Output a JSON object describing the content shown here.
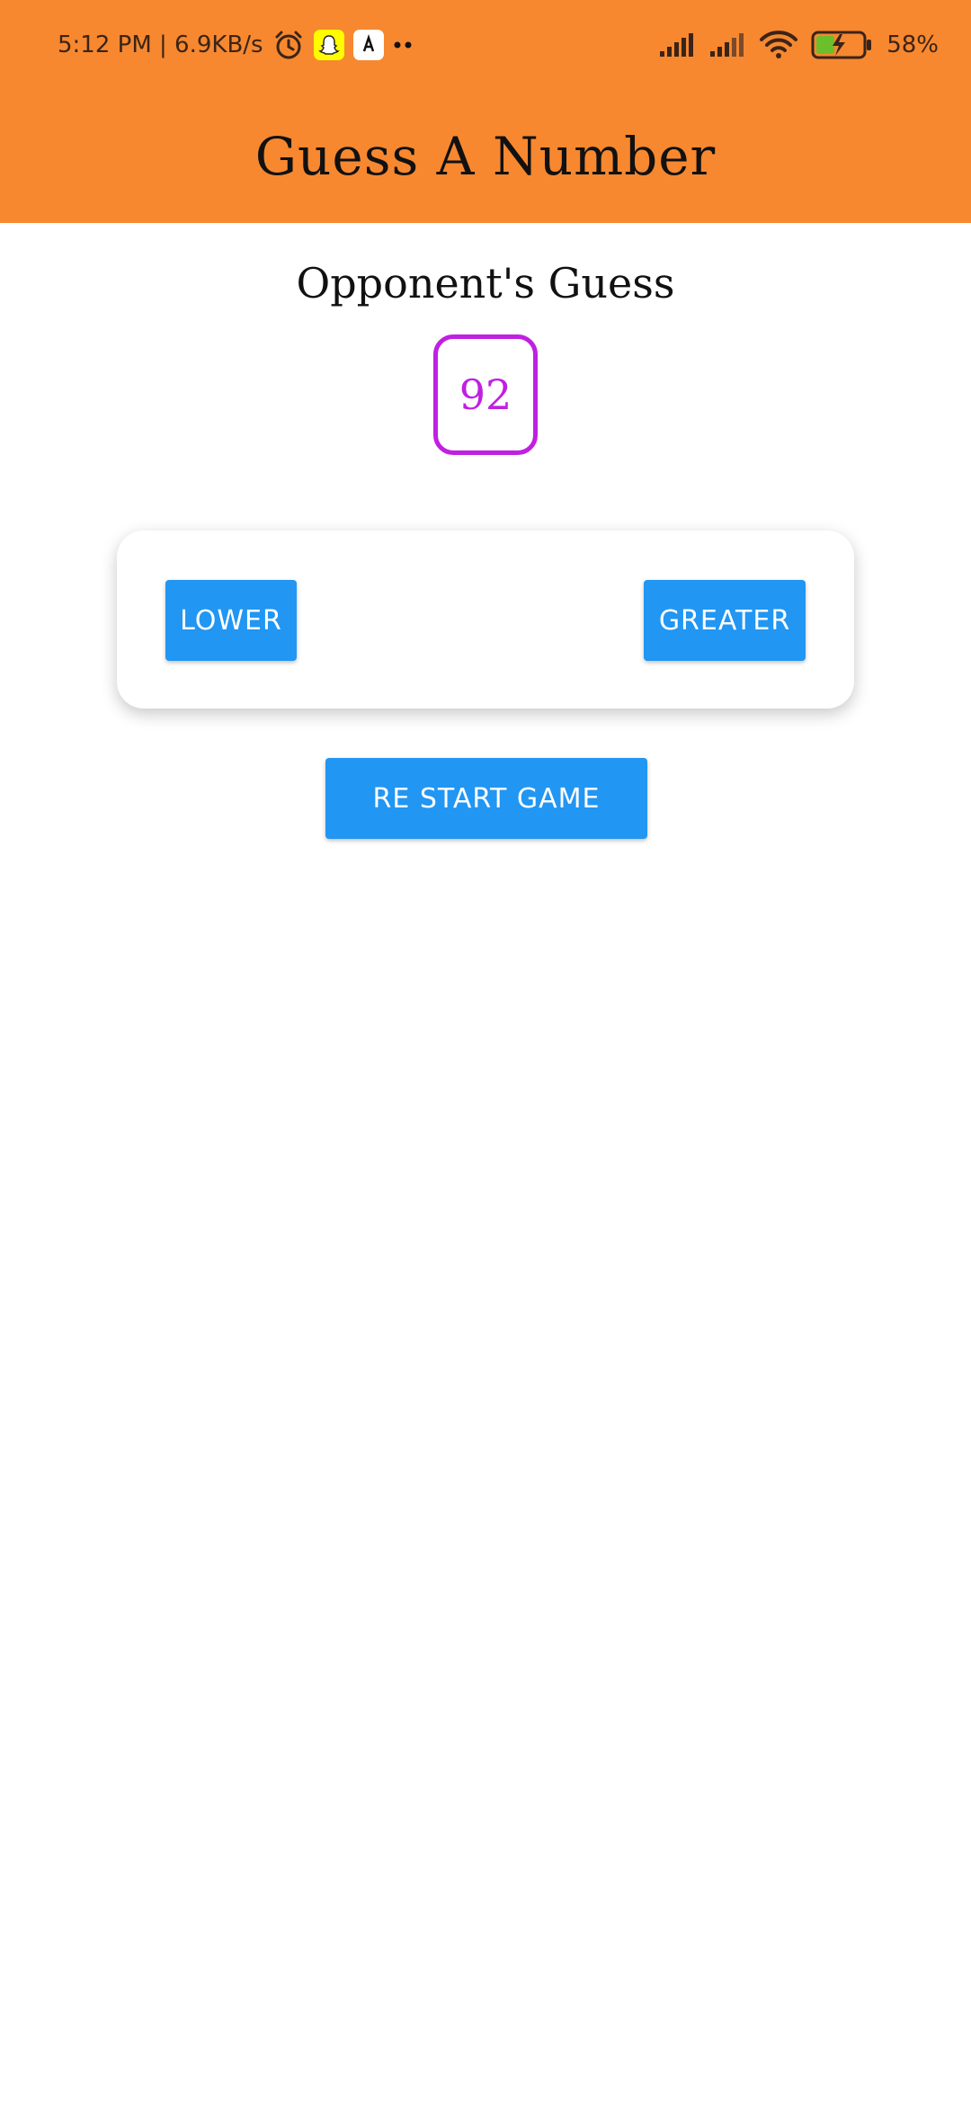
{
  "status_bar": {
    "time_and_speed": "5:12 PM | 6.9KB/s",
    "battery_percent": "58%",
    "icons": [
      "alarm-icon",
      "snapchat-icon",
      "app-notification-icon",
      "more-dots-icon",
      "signal-icon",
      "signal-icon",
      "wifi-icon",
      "battery-charging-icon"
    ]
  },
  "header": {
    "title": "Guess A Number"
  },
  "game": {
    "opponent_label": "Opponent's Guess",
    "opponent_guess": "92",
    "lower_label": "LOWER",
    "greater_label": "GREATER",
    "restart_label": "RE START GAME"
  },
  "colors": {
    "header_bg": "#F7882F",
    "button_bg": "#2196F3",
    "guess_accent": "#C020E0"
  }
}
